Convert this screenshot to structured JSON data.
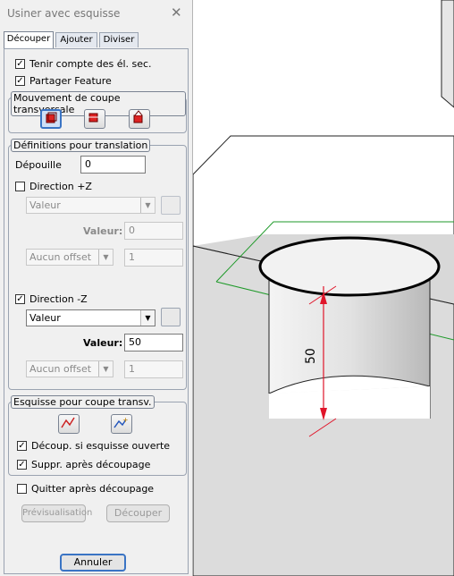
{
  "dialog": {
    "title": "Usiner avec esquisse",
    "close_glyph": "✕",
    "tabs": [
      "Découper",
      "Ajouter",
      "Diviser"
    ]
  },
  "options": {
    "tenir_compte": {
      "label": "Tenir compte des él. sec.",
      "checked": true
    },
    "partager": {
      "label": "Partager Feature",
      "checked": true
    }
  },
  "mouvement": {
    "title": "Mouvement de coupe transversale",
    "icons": [
      "cut-forward-icon",
      "cut-both-icon",
      "cut-reverse-icon"
    ]
  },
  "translation": {
    "title": "Définitions pour translation",
    "depouille_label": "Dépouille",
    "depouille_value": "0",
    "dir_plus": {
      "label": "Direction +Z",
      "checked": false,
      "select_value": "Valeur",
      "valeur_label": "Valeur:",
      "valeur_value": "0",
      "offset_select": "Aucun offset",
      "offset_value": "1"
    },
    "dir_minus": {
      "label": "Direction -Z",
      "checked": true,
      "select_value": "Valeur",
      "valeur_label": "Valeur:",
      "valeur_value": "50",
      "offset_select": "Aucun offset",
      "offset_value": "1"
    }
  },
  "esquisse": {
    "title": "Esquisse pour coupe transv.",
    "decoup_ouverte": {
      "label": "Découp. si esquisse ouverte",
      "checked": true
    },
    "suppr_apres": {
      "label": "Suppr. après découpage",
      "checked": true
    }
  },
  "quitter": {
    "label": "Quitter après découpage",
    "checked": false
  },
  "buttons": {
    "preview": "Prévisualisation",
    "decouper": "Découper",
    "annuler": "Annuler"
  },
  "viewport": {
    "dimension_label": "50"
  }
}
